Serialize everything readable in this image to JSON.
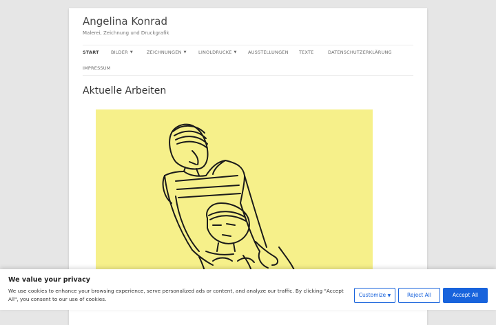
{
  "site": {
    "title": "Angelina Konrad",
    "description": "Malerei, Zeichnung und Druckgrafik"
  },
  "nav": {
    "items": [
      {
        "label": "START",
        "active": true,
        "dropdown": false
      },
      {
        "label": "BILDER",
        "active": false,
        "dropdown": true
      },
      {
        "label": "ZEICHNUNGEN",
        "active": false,
        "dropdown": true
      },
      {
        "label": "LINOLDRUCKE",
        "active": false,
        "dropdown": true
      },
      {
        "label": "AUSSTELLUNGEN",
        "active": false,
        "dropdown": false
      },
      {
        "label": "TEXTE",
        "active": false,
        "dropdown": false
      },
      {
        "label": "DATENSCHUTZERKLÄRUNG",
        "active": false,
        "dropdown": false
      },
      {
        "label": "IMPRESSUM",
        "active": false,
        "dropdown": false
      }
    ]
  },
  "content": {
    "heading": "Aktuelle Arbeiten",
    "artwork_icon": "drawing-of-adult-and-child"
  },
  "cookie": {
    "title": "We value your privacy",
    "text": "We use cookies to enhance your browsing experience, serve personalized ads or content, and analyze our traffic. By clicking \"Accept All\", you consent to our use of cookies.",
    "customize_label": "Customize",
    "reject_label": "Reject All",
    "accept_label": "Accept All"
  },
  "colors": {
    "background": "#e6e6e6",
    "artwork_yellow": "#f6f08a",
    "accent": "#1863dc"
  }
}
